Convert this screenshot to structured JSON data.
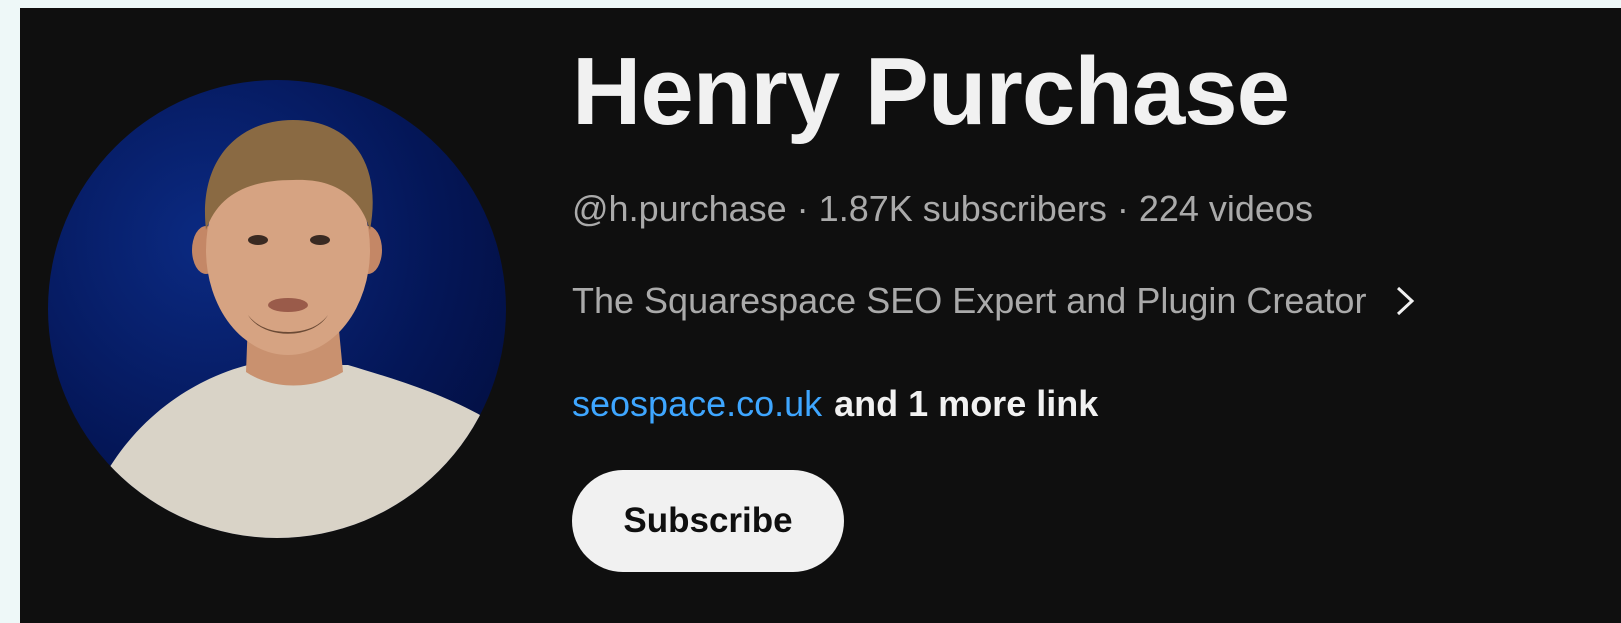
{
  "channel": {
    "name": "Henry Purchase",
    "handle": "@h.purchase",
    "separator": "·",
    "subscribers": "1.87K subscribers",
    "videos": "224 videos",
    "description": "The Squarespace SEO Expert and Plugin Creator",
    "link_text": "seospace.co.uk",
    "more_links": "and 1 more link",
    "subscribe_label": "Subscribe"
  },
  "icons": {
    "description_more": "chevron-right-icon",
    "avatar": "channel-avatar-photo"
  },
  "colors": {
    "background": "#0f0f0f",
    "title": "#f1f1f1",
    "meta_text": "#aaaaaa",
    "link": "#3ea6ff",
    "button_bg": "#f1f1f1",
    "button_text": "#0f0f0f",
    "avatar_bg": "#041657"
  }
}
